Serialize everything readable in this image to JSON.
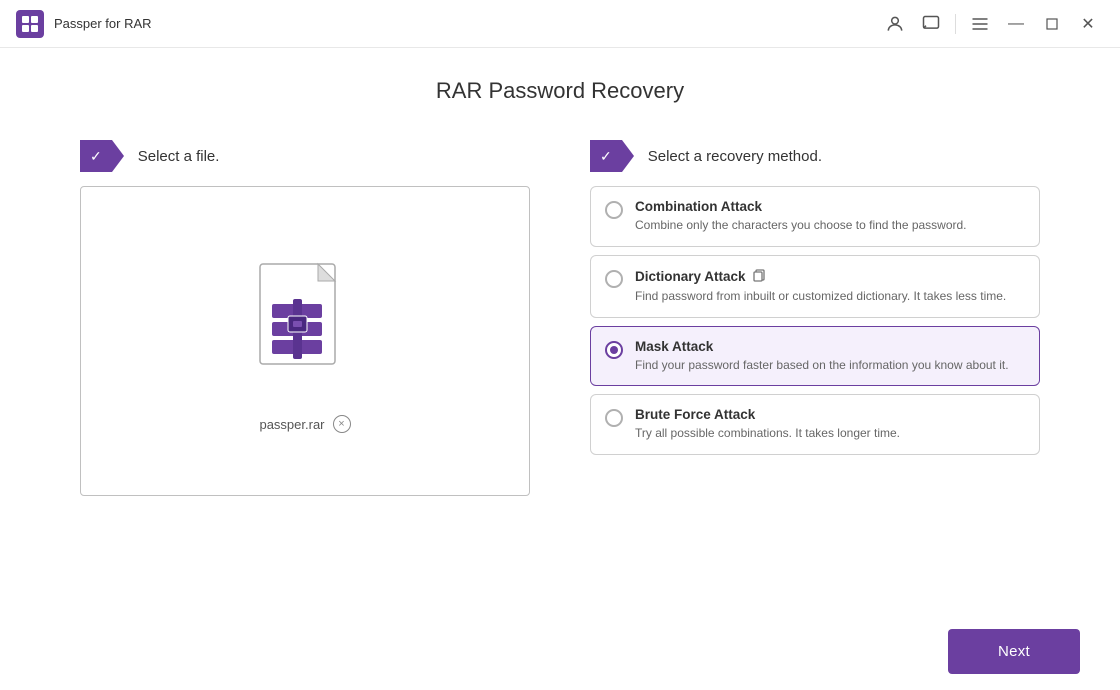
{
  "app": {
    "title": "Passper for RAR",
    "logo_alt": "app-logo"
  },
  "window_controls": {
    "minimize": "—",
    "maximize": "□",
    "close": "✕"
  },
  "page": {
    "title": "RAR Password Recovery"
  },
  "left_section": {
    "step_check": "✓",
    "label": "Select a file.",
    "file_name": "passper.rar",
    "close_symbol": "×"
  },
  "right_section": {
    "step_check": "✓",
    "label": "Select a recovery method.",
    "methods": [
      {
        "id": "combination",
        "name": "Combination Attack",
        "desc": "Combine only the characters you choose to find the password.",
        "selected": false,
        "has_icon": false
      },
      {
        "id": "dictionary",
        "name": "Dictionary Attack",
        "desc": "Find password from inbuilt or customized dictionary. It takes less time.",
        "selected": false,
        "has_icon": true
      },
      {
        "id": "mask",
        "name": "Mask Attack",
        "desc": "Find your password faster based on the information you know about it.",
        "selected": true,
        "has_icon": false
      },
      {
        "id": "bruteforce",
        "name": "Brute Force Attack",
        "desc": "Try all possible combinations. It takes longer time.",
        "selected": false,
        "has_icon": false
      }
    ]
  },
  "footer": {
    "next_label": "Next"
  }
}
